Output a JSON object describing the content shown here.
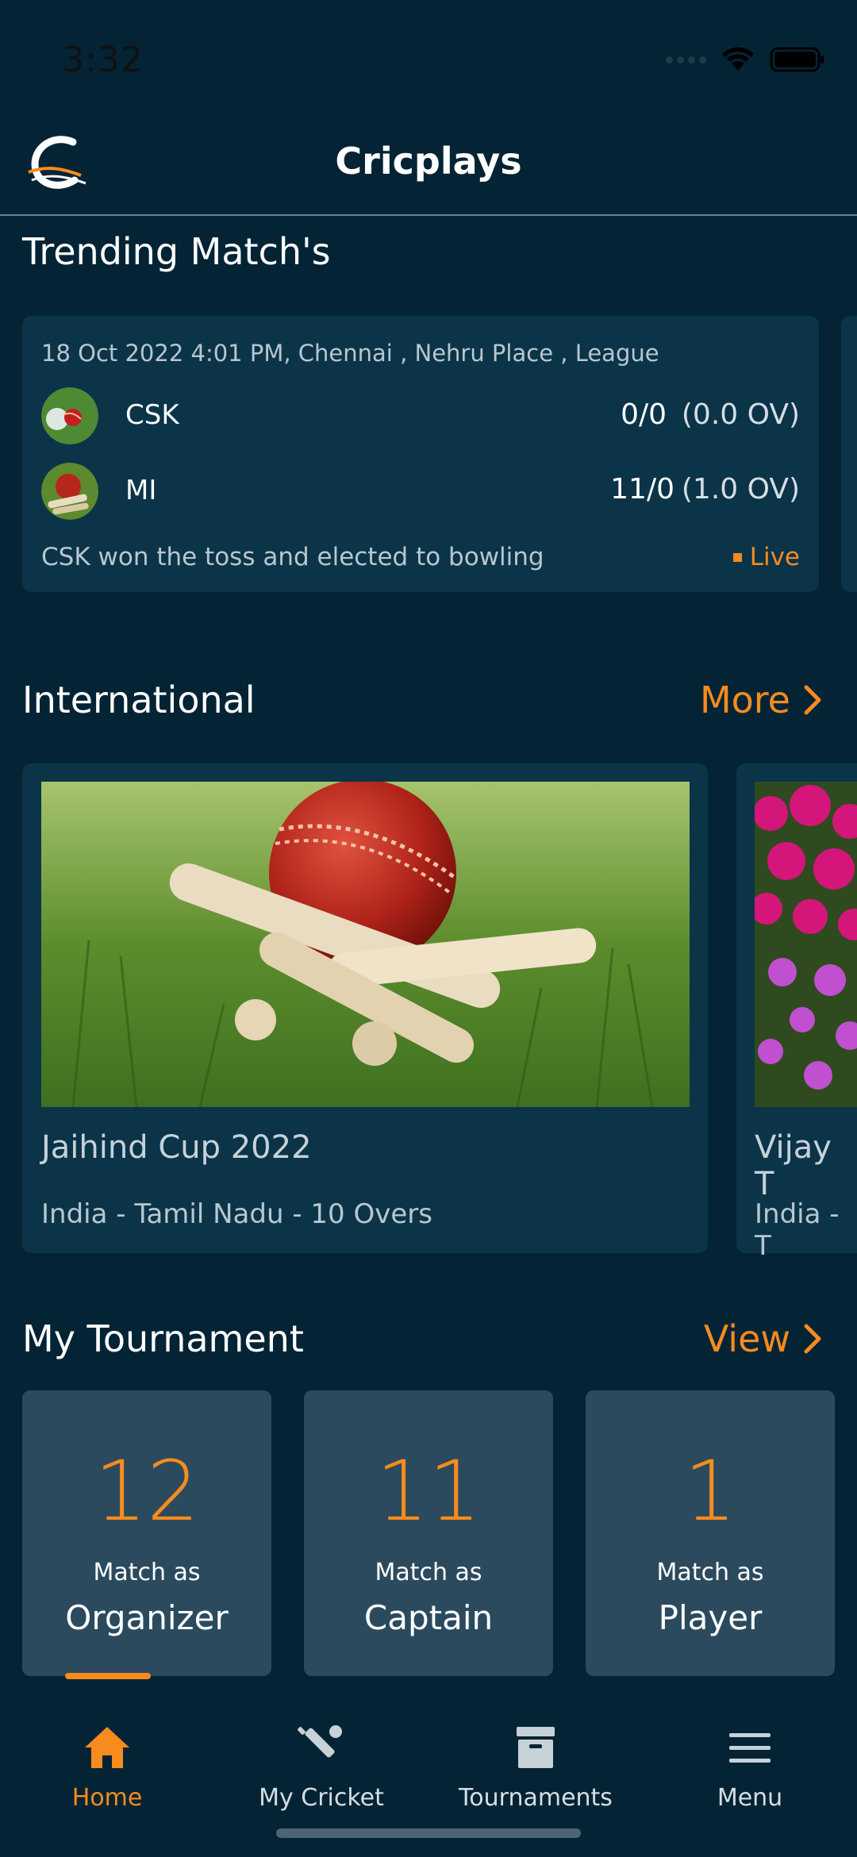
{
  "status_bar": {
    "time": "3:32"
  },
  "header": {
    "title": "Cricplays"
  },
  "trending": {
    "section_title": "Trending Match's",
    "match": {
      "meta": "18 Oct 2022 4:01 PM, Chennai , Nehru Place , League",
      "teams": [
        {
          "name": "CSK",
          "runs": "0/0",
          "overs": "(0.0 OV)"
        },
        {
          "name": "MI",
          "runs": "11/0",
          "overs": "(1.0 OV)"
        }
      ],
      "toss": "CSK won the toss and elected to bowling",
      "status": "Live"
    }
  },
  "international": {
    "section_title": "International",
    "more_label": "More",
    "cards": [
      {
        "name": "Jaihind Cup 2022",
        "details": "India - Tamil Nadu - 10 Overs"
      },
      {
        "name": "Vijay T",
        "details": "India - T"
      }
    ]
  },
  "my_tournament": {
    "section_title": "My Tournament",
    "view_label": "View",
    "stats": [
      {
        "count": "12",
        "caption": "Match as",
        "role": "Organizer"
      },
      {
        "count": "11",
        "caption": "Match as",
        "role": "Captain"
      },
      {
        "count": "1",
        "caption": "Match as",
        "role": "Player"
      }
    ]
  },
  "bottom_nav": {
    "items": [
      {
        "label": "Home",
        "icon": "home-icon",
        "active": true
      },
      {
        "label": "My Cricket",
        "icon": "cricket-bat-icon",
        "active": false
      },
      {
        "label": "Tournaments",
        "icon": "archive-box-icon",
        "active": false
      },
      {
        "label": "Menu",
        "icon": "hamburger-menu-icon",
        "active": false
      }
    ]
  },
  "colors": {
    "background": "#042435",
    "card": "#0b3449",
    "tile": "#2b4a5e",
    "accent": "#f68b1e"
  }
}
